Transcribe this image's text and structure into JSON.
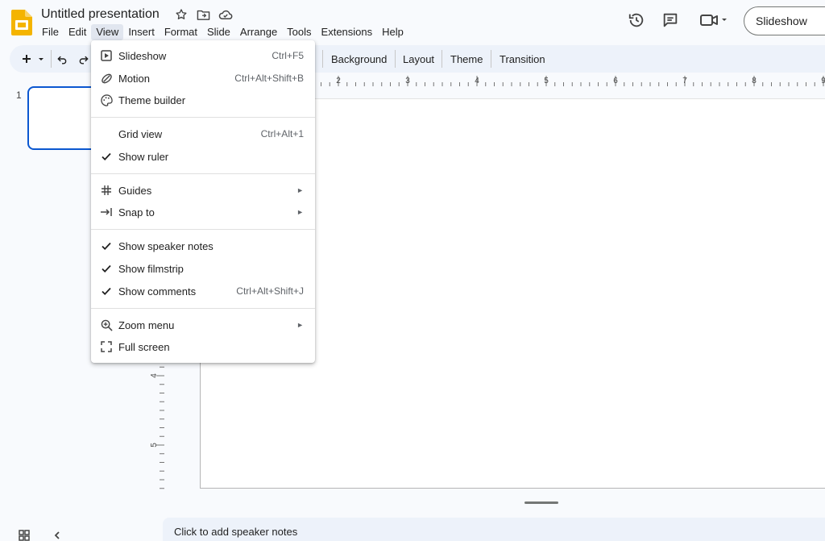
{
  "title_bar": {
    "doc_title": "Untitled presentation",
    "slideshow_label": "Slideshow"
  },
  "menubar": [
    {
      "label": "File"
    },
    {
      "label": "Edit"
    },
    {
      "label": "View"
    },
    {
      "label": "Insert"
    },
    {
      "label": "Format"
    },
    {
      "label": "Slide"
    },
    {
      "label": "Arrange"
    },
    {
      "label": "Tools"
    },
    {
      "label": "Extensions"
    },
    {
      "label": "Help"
    }
  ],
  "toolbar": {
    "background": "Background",
    "layout": "Layout",
    "theme": "Theme",
    "transition": "Transition"
  },
  "filmstrip": {
    "slide_number": "1"
  },
  "ruler": {
    "h_ticks": [
      "2",
      "3",
      "4",
      "5",
      "6",
      "7",
      "8",
      "9"
    ],
    "v_ticks": [
      "4",
      "5"
    ]
  },
  "notes": {
    "placeholder": "Click to add speaker notes"
  },
  "view_menu": {
    "items": [
      {
        "label": "Slideshow",
        "shortcut": "Ctrl+F5",
        "icon": "play-box-icon"
      },
      {
        "label": "Motion",
        "shortcut": "Ctrl+Alt+Shift+B",
        "icon": "motion-icon"
      },
      {
        "label": "Theme builder",
        "shortcut": "",
        "icon": "palette-icon"
      },
      {
        "label": "Grid view",
        "shortcut": "Ctrl+Alt+1",
        "icon": ""
      },
      {
        "label": "Show ruler",
        "shortcut": "",
        "icon": "check-icon"
      },
      {
        "label": "Guides",
        "shortcut": "",
        "icon": "hash-icon"
      },
      {
        "label": "Snap to",
        "shortcut": "",
        "icon": "arrow-to-line-icon"
      },
      {
        "label": "Show speaker notes",
        "shortcut": "",
        "icon": "check-icon"
      },
      {
        "label": "Show filmstrip",
        "shortcut": "",
        "icon": "check-icon"
      },
      {
        "label": "Show comments",
        "shortcut": "Ctrl+Alt+Shift+J",
        "icon": "check-icon"
      },
      {
        "label": "Zoom menu",
        "shortcut": "",
        "icon": "zoom-in-icon"
      },
      {
        "label": "Full screen",
        "shortcut": "",
        "icon": "fullscreen-icon"
      }
    ]
  },
  "colors": {
    "accent": "#0b57d0",
    "logo": "#f4b400",
    "background": "#f8fafd",
    "toolbar": "#edf2fa"
  }
}
